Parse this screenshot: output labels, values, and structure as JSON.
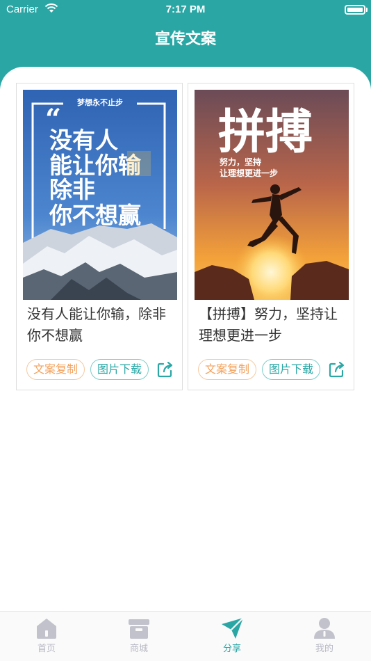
{
  "status_bar": {
    "carrier": "Carrier",
    "time": "7:17 PM"
  },
  "nav": {
    "title": "宣传文案"
  },
  "cards": [
    {
      "poster": {
        "tag": "梦想永不止步",
        "lines": [
          "没有人",
          "能让你输",
          "除非",
          "你不想赢"
        ],
        "quote": "“"
      },
      "text": "没有人能让你输，除非你不想赢",
      "copy_label": "文案复制",
      "download_label": "图片下载"
    },
    {
      "poster": {
        "headline": "拼搏",
        "sub1": "努力，坚持",
        "sub2": "让理想更进一步"
      },
      "text": "【拼搏】努力，坚持让理想更进一步",
      "copy_label": "文案复制",
      "download_label": "图片下载"
    }
  ],
  "tabs": [
    {
      "label": "首页",
      "icon": "home-icon"
    },
    {
      "label": "商城",
      "icon": "shop-icon"
    },
    {
      "label": "分享",
      "icon": "paper-plane-icon",
      "active": true
    },
    {
      "label": "我的",
      "icon": "person-icon"
    }
  ],
  "colors": {
    "accent": "#2aa7a5",
    "copy_chip": "#f3a15c",
    "tab_inactive": "#b9b9c6"
  }
}
